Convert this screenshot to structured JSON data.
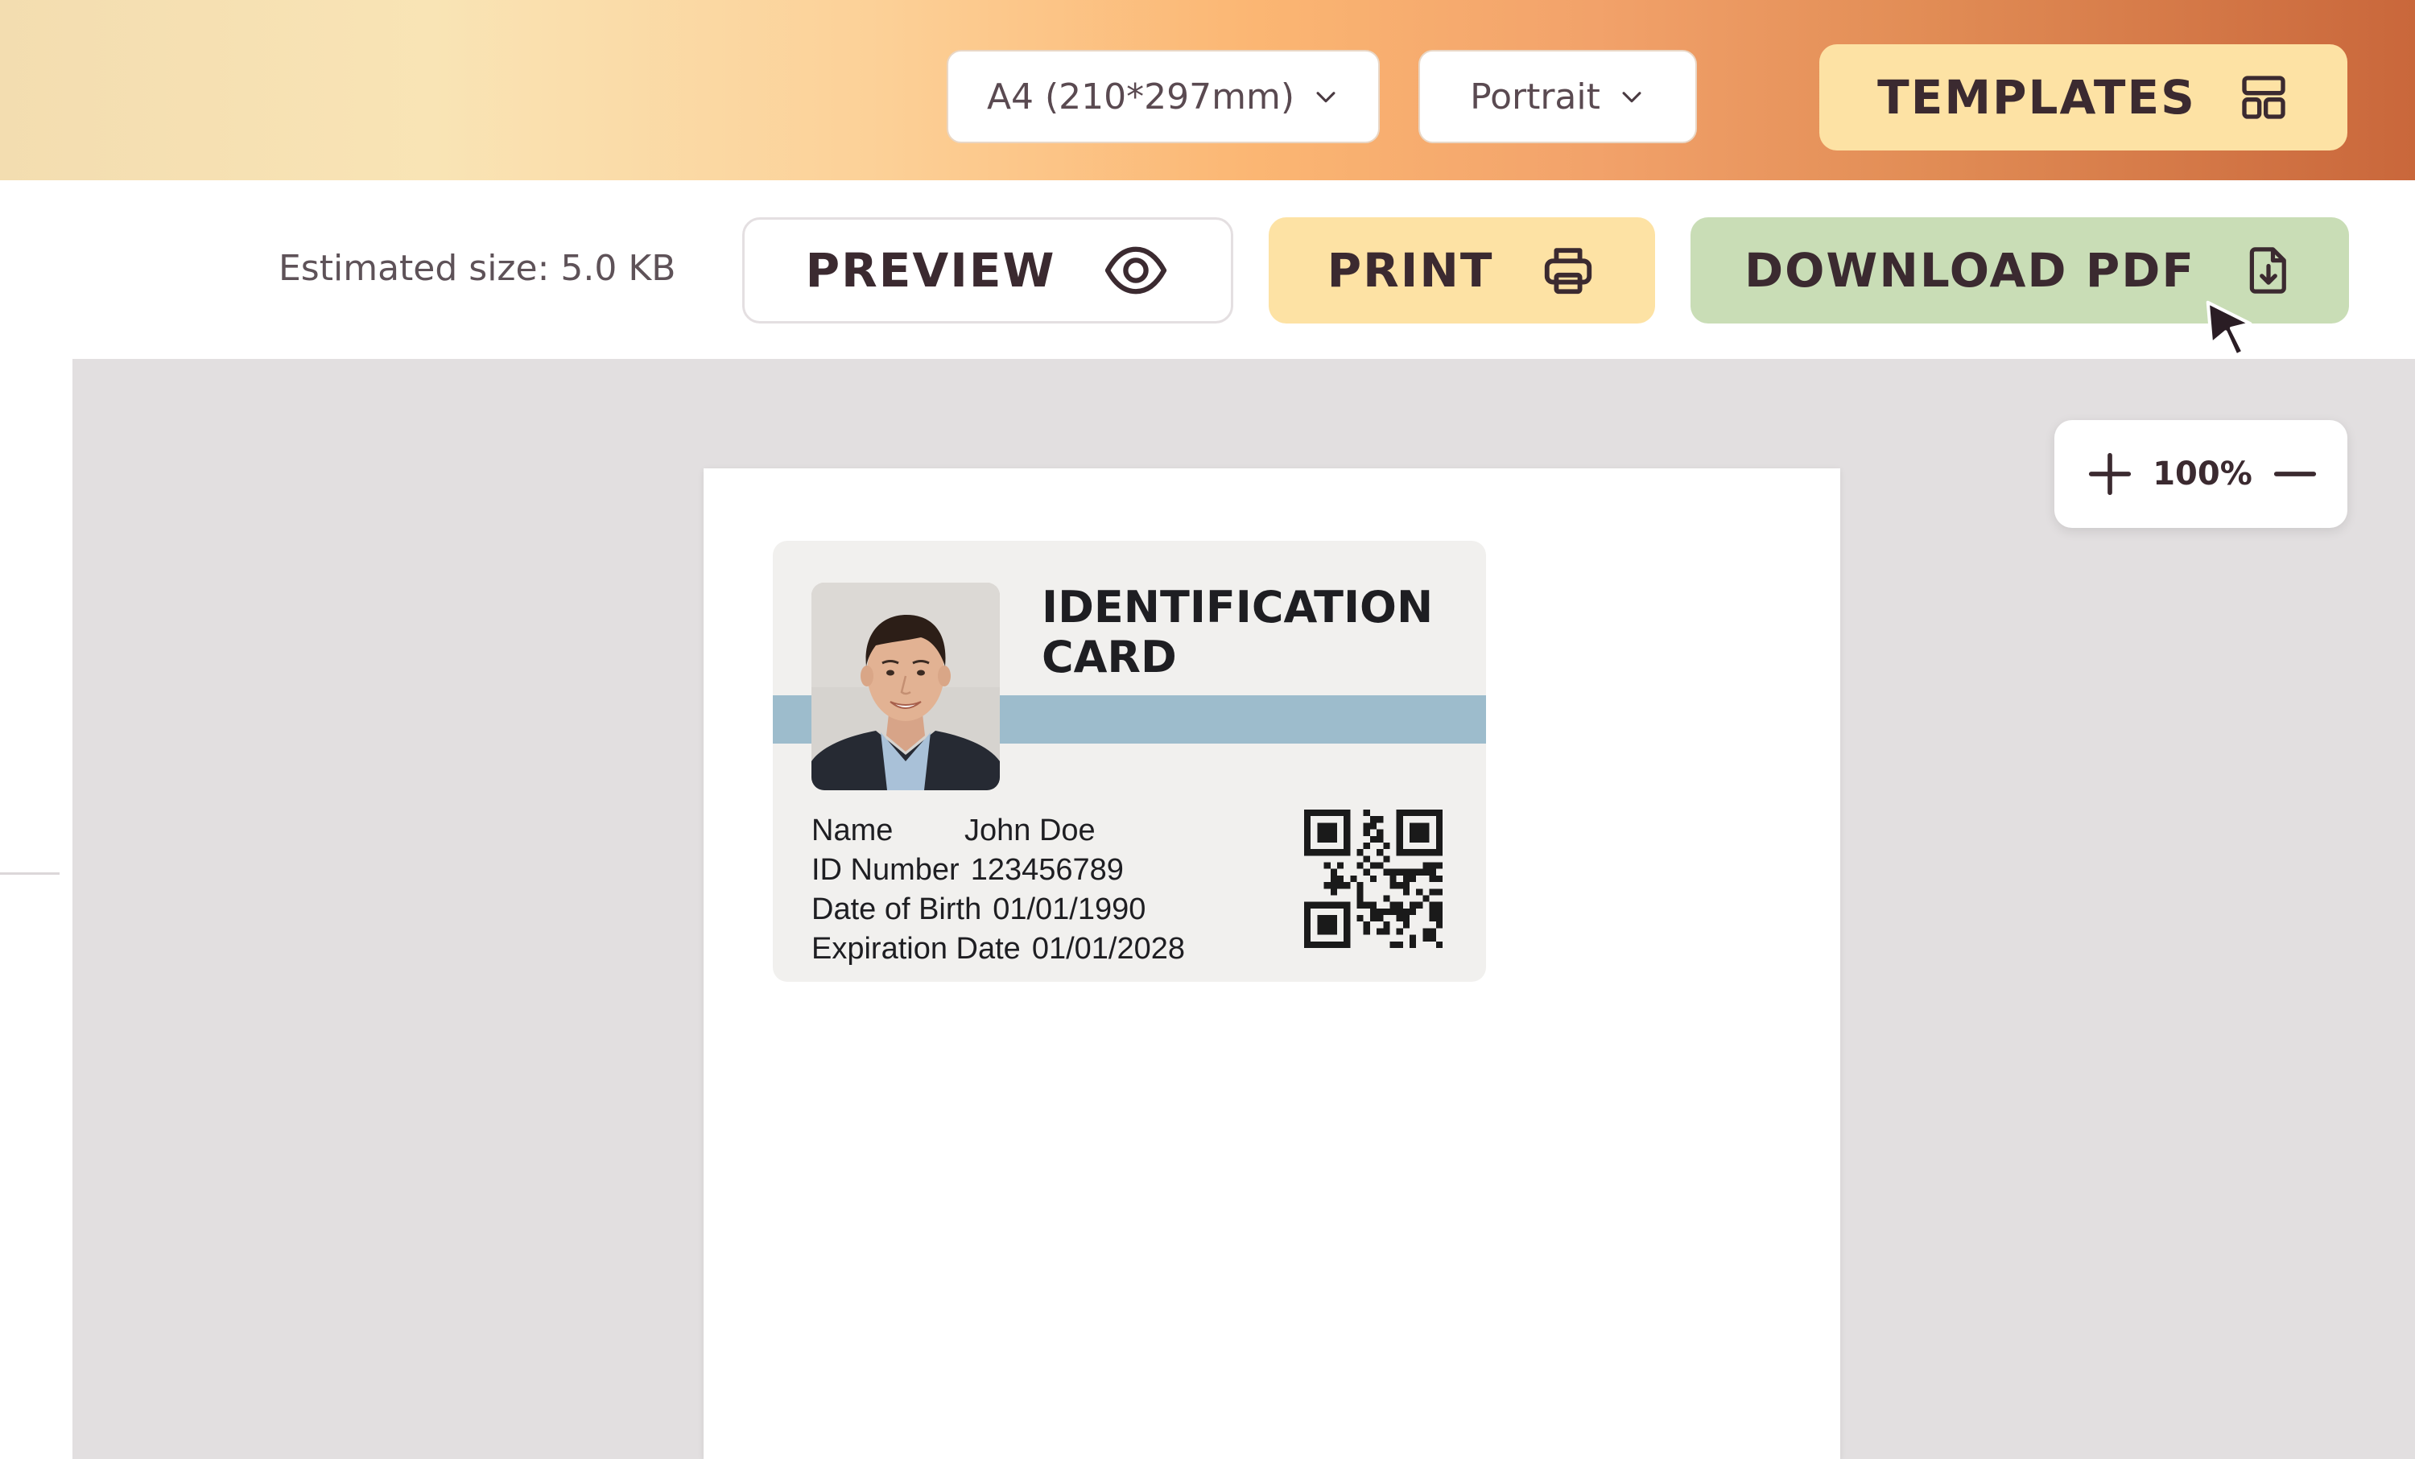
{
  "toolbar": {
    "page_size": "A4 (210*297mm)",
    "orientation": "Portrait",
    "templates_label": "TEMPLATES"
  },
  "actions": {
    "estimated_size": "Estimated size: 5.0 KB",
    "preview_label": "PREVIEW",
    "print_label": "PRINT",
    "download_label": "DOWNLOAD PDF"
  },
  "zoom": {
    "value": "100%"
  },
  "card": {
    "title_line1": "IDENTIFICATION",
    "title_line2": "CARD",
    "fields": [
      {
        "label": "Name",
        "value": "John Doe"
      },
      {
        "label": "ID Number",
        "value": "123456789"
      },
      {
        "label": "Date of Birth",
        "value": "01/01/1990"
      },
      {
        "label": "Expiration Date",
        "value": "01/01/2028"
      }
    ]
  },
  "icons": {
    "page_size_dropdown": "chevron-down-icon",
    "orientation_dropdown": "chevron-down-icon",
    "templates": "layout-grid-icon",
    "preview": "eye-icon",
    "print": "printer-icon",
    "download": "file-download-icon",
    "zoom_in": "plus-icon",
    "zoom_out": "minus-icon",
    "cursor": "mouse-pointer-icon"
  },
  "colors": {
    "accent_yellow": "#fde2a4",
    "accent_green": "#c9ddb6",
    "card_band": "#9dbccc",
    "text_dark": "#3b2a30"
  }
}
